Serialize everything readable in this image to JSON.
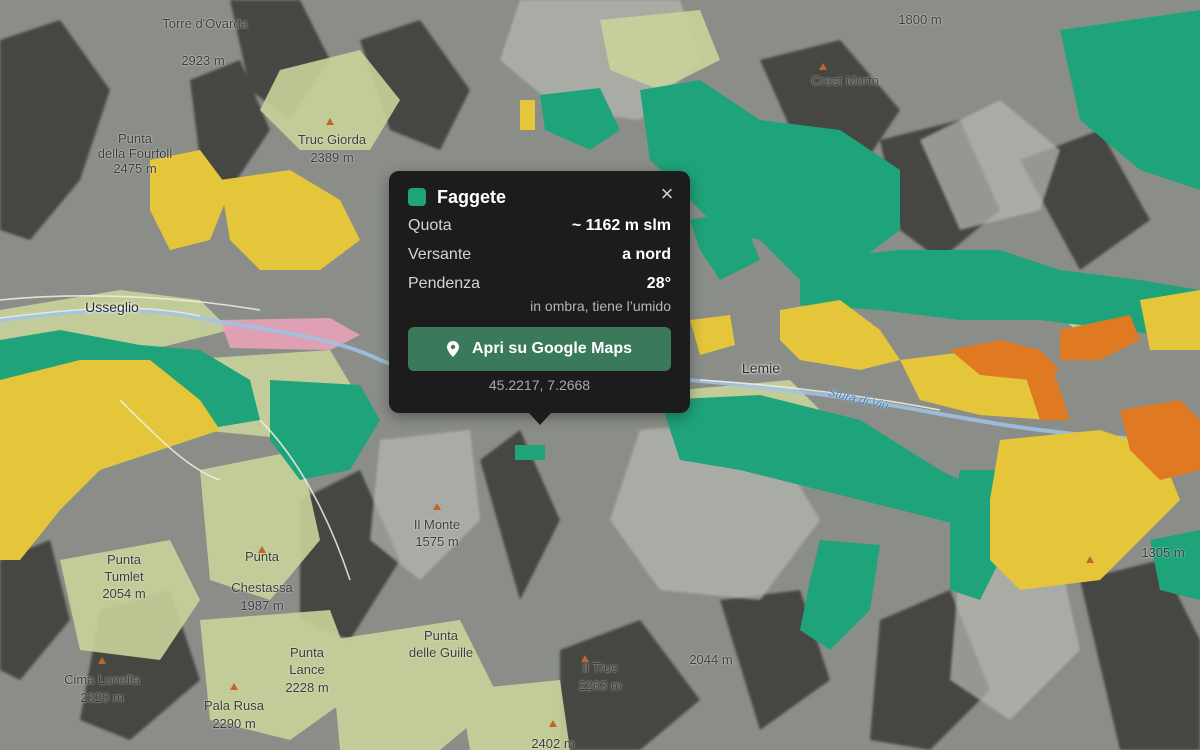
{
  "map": {
    "labels": [
      {
        "id": "torre-ovarda",
        "text": "Torre d'Ovarda"
      },
      {
        "id": "ovarda-elev",
        "text": "2923 m"
      },
      {
        "id": "punta-fourfoll",
        "text": "Punta"
      },
      {
        "id": "punta-fourfoll-2",
        "text": "della Fourfoll"
      },
      {
        "id": "punta-fourfoll-elev",
        "text": "2475 m"
      },
      {
        "id": "truc-giorda",
        "text": "Truc Giorda"
      },
      {
        "id": "truc-giorda-elev",
        "text": "2389 m"
      },
      {
        "id": "alpe-elev",
        "text": "1800 m"
      },
      {
        "id": "cresta-elev",
        "text": "Crest Morto"
      },
      {
        "id": "usseglio",
        "text": "Usseglio"
      },
      {
        "id": "lemie",
        "text": "Lemie"
      },
      {
        "id": "stura",
        "text": "Stura di Viù"
      },
      {
        "id": "il-monte",
        "text": "Il Monte"
      },
      {
        "id": "il-monte-elev",
        "text": "1575 m"
      },
      {
        "id": "punta-tumlet",
        "text": "Punta"
      },
      {
        "id": "punta-tumlet-2",
        "text": "Tumlet"
      },
      {
        "id": "punta-tumlet-elev",
        "text": "2054 m"
      },
      {
        "id": "punta-chestassa",
        "text": "Punta"
      },
      {
        "id": "punta-chestassa-2",
        "text": "Chestassa"
      },
      {
        "id": "punta-chestassa-elev",
        "text": "1987 m"
      },
      {
        "id": "punta-lance",
        "text": "Punta"
      },
      {
        "id": "punta-lance-2",
        "text": "Lance"
      },
      {
        "id": "punta-lance-elev",
        "text": "2228 m"
      },
      {
        "id": "punta-guille",
        "text": "Punta"
      },
      {
        "id": "punta-guille-2",
        "text": "delle Guille"
      },
      {
        "id": "cima-lunella",
        "text": "Cima Lunella"
      },
      {
        "id": "cima-lunella-elev",
        "text": "2320 m"
      },
      {
        "id": "pala-rusa",
        "text": "Pala Rusa"
      },
      {
        "id": "pala-rusa-elev",
        "text": "2290 m"
      },
      {
        "id": "il-truc",
        "text": "Il Truc"
      },
      {
        "id": "il-truc-elev",
        "text": "2263 m"
      },
      {
        "id": "elev-2044",
        "text": "2044 m"
      },
      {
        "id": "elev-2402",
        "text": "2402 m"
      },
      {
        "id": "elev-1305",
        "text": "1305 m"
      }
    ]
  },
  "popup": {
    "title": "Faggete",
    "swatch_color": "#1fa37a",
    "close_label": "×",
    "rows": [
      {
        "key": "Quota",
        "value": "~ 1162 m slm"
      },
      {
        "key": "Versante",
        "value": "a nord"
      },
      {
        "key": "Pendenza",
        "value": "28°"
      }
    ],
    "note": "in ombra, tiene l’umido",
    "button_label": "Apri su Google Maps",
    "button_icon": "map-pin-icon",
    "coords": "45.2217, 7.2668"
  },
  "colors": {
    "faggete": "#1fa37a",
    "larici": "#e8c83a",
    "castagni": "#e07b22",
    "rock": "#8d908a",
    "meadow": "#c8d49a",
    "urban": "#e8a0b8"
  }
}
